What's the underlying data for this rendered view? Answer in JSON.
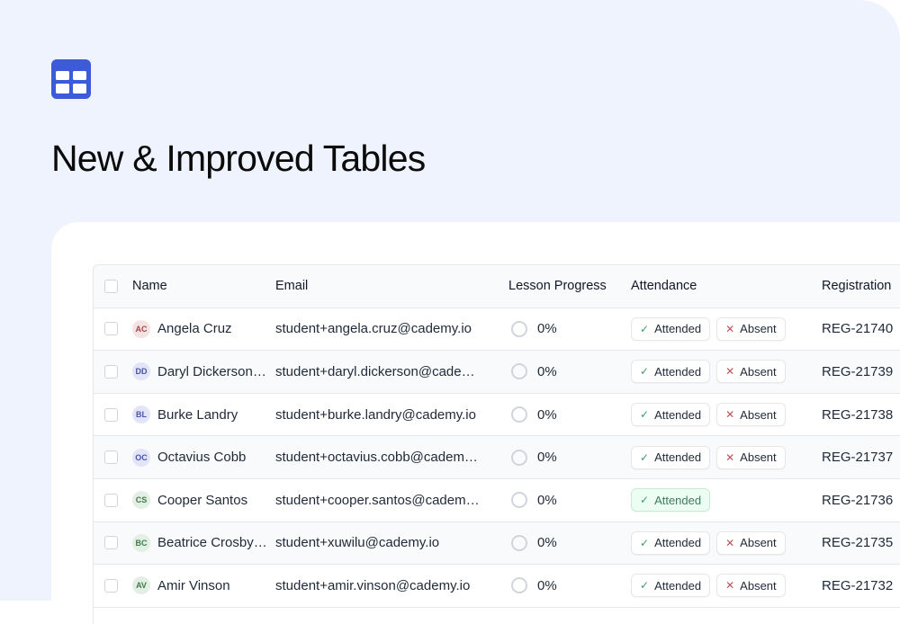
{
  "page": {
    "title": "New & Improved Tables",
    "logo_icon": "table-grid-icon",
    "accent": "#3d5bd9"
  },
  "table": {
    "columns": {
      "name": "Name",
      "email": "Email",
      "progress": "Lesson Progress",
      "attendance": "Attendance",
      "registration": "Registration"
    },
    "attended_label": "Attended",
    "absent_label": "Absent",
    "rows": [
      {
        "initials": "AC",
        "avatar_bg": "#f3e4e4",
        "avatar_fg": "#a14646",
        "name": "Angela Cruz",
        "email": "student+angela.cruz@cademy.io",
        "progress": "0%",
        "attended_active": false,
        "show_absent": true,
        "registration": "REG-21740"
      },
      {
        "initials": "DD",
        "avatar_bg": "#e2e5f7",
        "avatar_fg": "#4a55a6",
        "name": "Daryl Dickerson…",
        "email": "student+daryl.dickerson@cade…",
        "progress": "0%",
        "attended_active": false,
        "show_absent": true,
        "registration": "REG-21739"
      },
      {
        "initials": "BL",
        "avatar_bg": "#e2e5f7",
        "avatar_fg": "#4a55a6",
        "name": "Burke Landry",
        "email": "student+burke.landry@cademy.io",
        "progress": "0%",
        "attended_active": false,
        "show_absent": true,
        "registration": "REG-21738"
      },
      {
        "initials": "OC",
        "avatar_bg": "#e2e5f7",
        "avatar_fg": "#4a55a6",
        "name": "Octavius Cobb",
        "email": "student+octavius.cobb@cadem…",
        "progress": "0%",
        "attended_active": false,
        "show_absent": true,
        "registration": "REG-21737"
      },
      {
        "initials": "CS",
        "avatar_bg": "#e3efe4",
        "avatar_fg": "#3f7a4a",
        "name": "Cooper Santos",
        "email": "student+cooper.santos@cadem…",
        "progress": "0%",
        "attended_active": true,
        "show_absent": false,
        "registration": "REG-21736"
      },
      {
        "initials": "BC",
        "avatar_bg": "#e3efe4",
        "avatar_fg": "#3f7a4a",
        "name": "Beatrice Crosby…",
        "email": "student+xuwilu@cademy.io",
        "progress": "0%",
        "attended_active": false,
        "show_absent": true,
        "registration": "REG-21735"
      },
      {
        "initials": "AV",
        "avatar_bg": "#e3efe4",
        "avatar_fg": "#3f7a4a",
        "name": "Amir Vinson",
        "email": "student+amir.vinson@cademy.io",
        "progress": "0%",
        "attended_active": false,
        "show_absent": true,
        "registration": "REG-21732"
      }
    ]
  }
}
